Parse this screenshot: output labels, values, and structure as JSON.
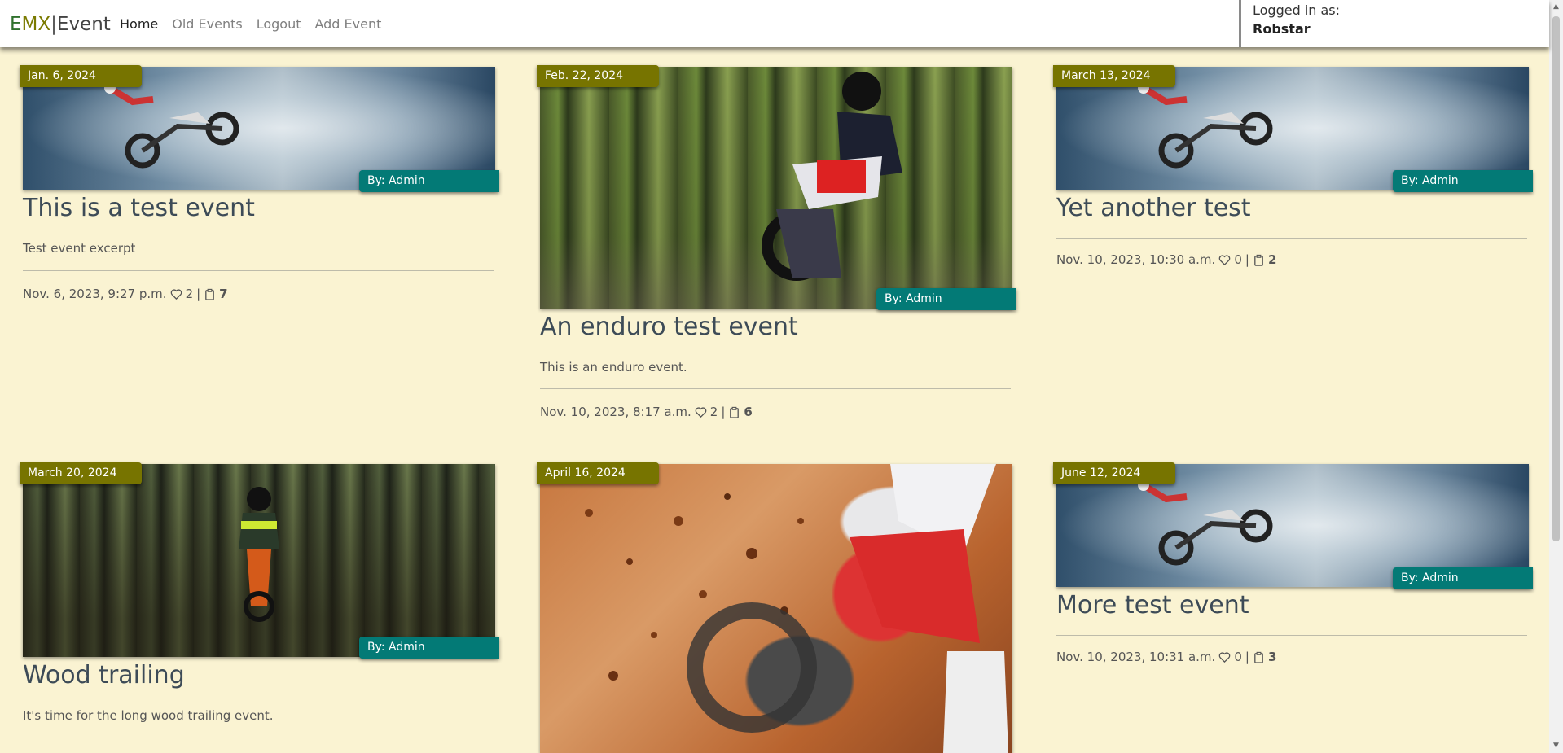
{
  "brand": {
    "e": "E",
    "mx": "MX",
    "sep": "|",
    "event": "Event"
  },
  "nav": [
    "Home",
    "Old Events",
    "Logout",
    "Add Event"
  ],
  "login": {
    "label": "Logged in as:",
    "user": "Robstar"
  },
  "cards": [
    {
      "date": "Jan. 6, 2024",
      "author": "By: Admin",
      "title": "This is a test event",
      "excerpt": "Test event excerpt",
      "posted": "Nov. 6, 2023, 9:27 p.m.",
      "likes": "2",
      "comments": "7",
      "image": "smoke-jump"
    },
    {
      "date": "Feb. 22, 2024",
      "author": "By: Admin",
      "title": "An enduro test event",
      "excerpt": "This is an enduro event.",
      "posted": "Nov. 10, 2023, 8:17 a.m.",
      "likes": "2",
      "comments": "6",
      "image": "forest-enduro"
    },
    {
      "date": "March 13, 2024",
      "author": "By: Admin",
      "title": "Yet another test",
      "excerpt": "",
      "posted": "Nov. 10, 2023, 10:30 a.m.",
      "likes": "0",
      "comments": "2",
      "image": "smoke-jump"
    },
    {
      "date": "March 20, 2024",
      "author": "By: Admin",
      "title": "Wood trailing",
      "excerpt": "It's time for the long wood trailing event.",
      "posted": "",
      "likes": "",
      "comments": "",
      "image": "wood-trail"
    },
    {
      "date": "April 16, 2024",
      "author": "",
      "title": "",
      "excerpt": "",
      "posted": "",
      "likes": "",
      "comments": "",
      "image": "dirt-closeup"
    },
    {
      "date": "June 12, 2024",
      "author": "By: Admin",
      "title": "More test event",
      "excerpt": "",
      "posted": "Nov. 10, 2023, 10:31 a.m.",
      "likes": "0",
      "comments": "3",
      "image": "smoke-jump"
    }
  ],
  "icons": {
    "like": "heart-outline-icon",
    "comment": "clipboard-icon"
  },
  "colors": {
    "background": "#faf3d2",
    "date_badge": "#777400",
    "author_badge": "#037a76",
    "brand_e": "#30712d",
    "brand_mx": "#7a7a00"
  }
}
